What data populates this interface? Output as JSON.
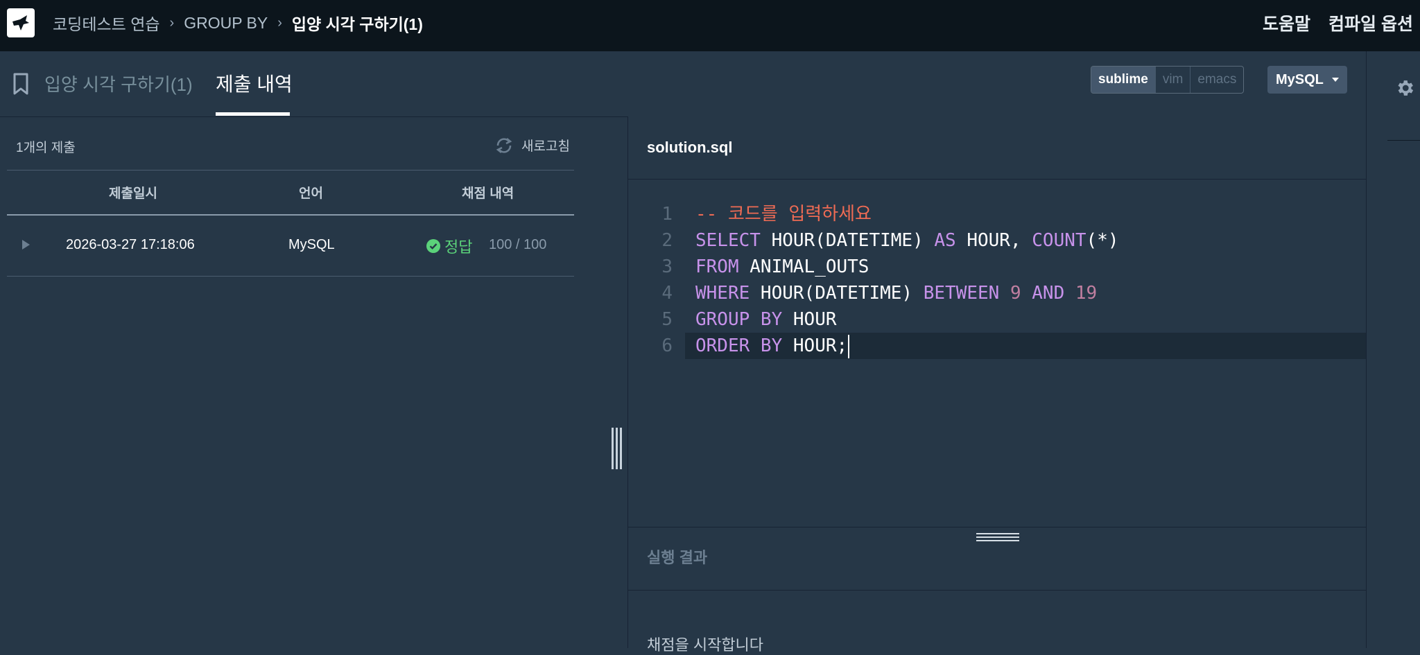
{
  "header": {
    "breadcrumbs": [
      "코딩테스트 연습",
      "GROUP BY"
    ],
    "current": "입양 시각 구하기(1)",
    "right_links": [
      "도움말",
      "컴파일 옵션"
    ]
  },
  "tabs": {
    "problem": "입양 시각 구하기(1)",
    "submissions": "제출 내역"
  },
  "keymaps": [
    "sublime",
    "vim",
    "emacs"
  ],
  "language_select": "MySQL",
  "submissions": {
    "count_label": "1개의 제출",
    "refresh_label": "새로고침",
    "columns": [
      "제출일시",
      "언어",
      "채점 내역"
    ],
    "rows": [
      {
        "date": "2026-03-27 17:18:06",
        "language": "MySQL",
        "result": "정답",
        "score": "100 / 100"
      }
    ]
  },
  "editor": {
    "filename": "solution.sql",
    "line_numbers": [
      "1",
      "2",
      "3",
      "4",
      "5",
      "6"
    ],
    "lines": [
      [
        {
          "t": "-- 코드를 입력하세요",
          "c": "cm"
        }
      ],
      [
        {
          "t": "SELECT",
          "c": "kw"
        },
        {
          "t": " HOUR(DATETIME) ",
          "c": ""
        },
        {
          "t": "AS",
          "c": "kw"
        },
        {
          "t": " HOUR, ",
          "c": ""
        },
        {
          "t": "COUNT",
          "c": "kw"
        },
        {
          "t": "(*)",
          "c": ""
        }
      ],
      [
        {
          "t": "FROM",
          "c": "kw"
        },
        {
          "t": " ANIMAL_OUTS",
          "c": ""
        }
      ],
      [
        {
          "t": "WHERE",
          "c": "kw"
        },
        {
          "t": " HOUR(DATETIME) ",
          "c": ""
        },
        {
          "t": "BETWEEN",
          "c": "kw"
        },
        {
          "t": " ",
          "c": ""
        },
        {
          "t": "9",
          "c": "num"
        },
        {
          "t": " ",
          "c": ""
        },
        {
          "t": "AND",
          "c": "kw"
        },
        {
          "t": " ",
          "c": ""
        },
        {
          "t": "19",
          "c": "num"
        }
      ],
      [
        {
          "t": "GROUP BY",
          "c": "kw"
        },
        {
          "t": " HOUR",
          "c": ""
        }
      ],
      [
        {
          "t": "ORDER BY",
          "c": "kw"
        },
        {
          "t": " HOUR;",
          "c": ""
        }
      ]
    ]
  },
  "output": {
    "title": "실행 결과",
    "text": "채점을 시작합니다"
  },
  "colors": {
    "background": "#263747",
    "topbar": "#0c151c",
    "keyword": "#c792ea",
    "number": "#c07fa0",
    "comment": "#ef6b54",
    "success": "#5bd27a"
  }
}
